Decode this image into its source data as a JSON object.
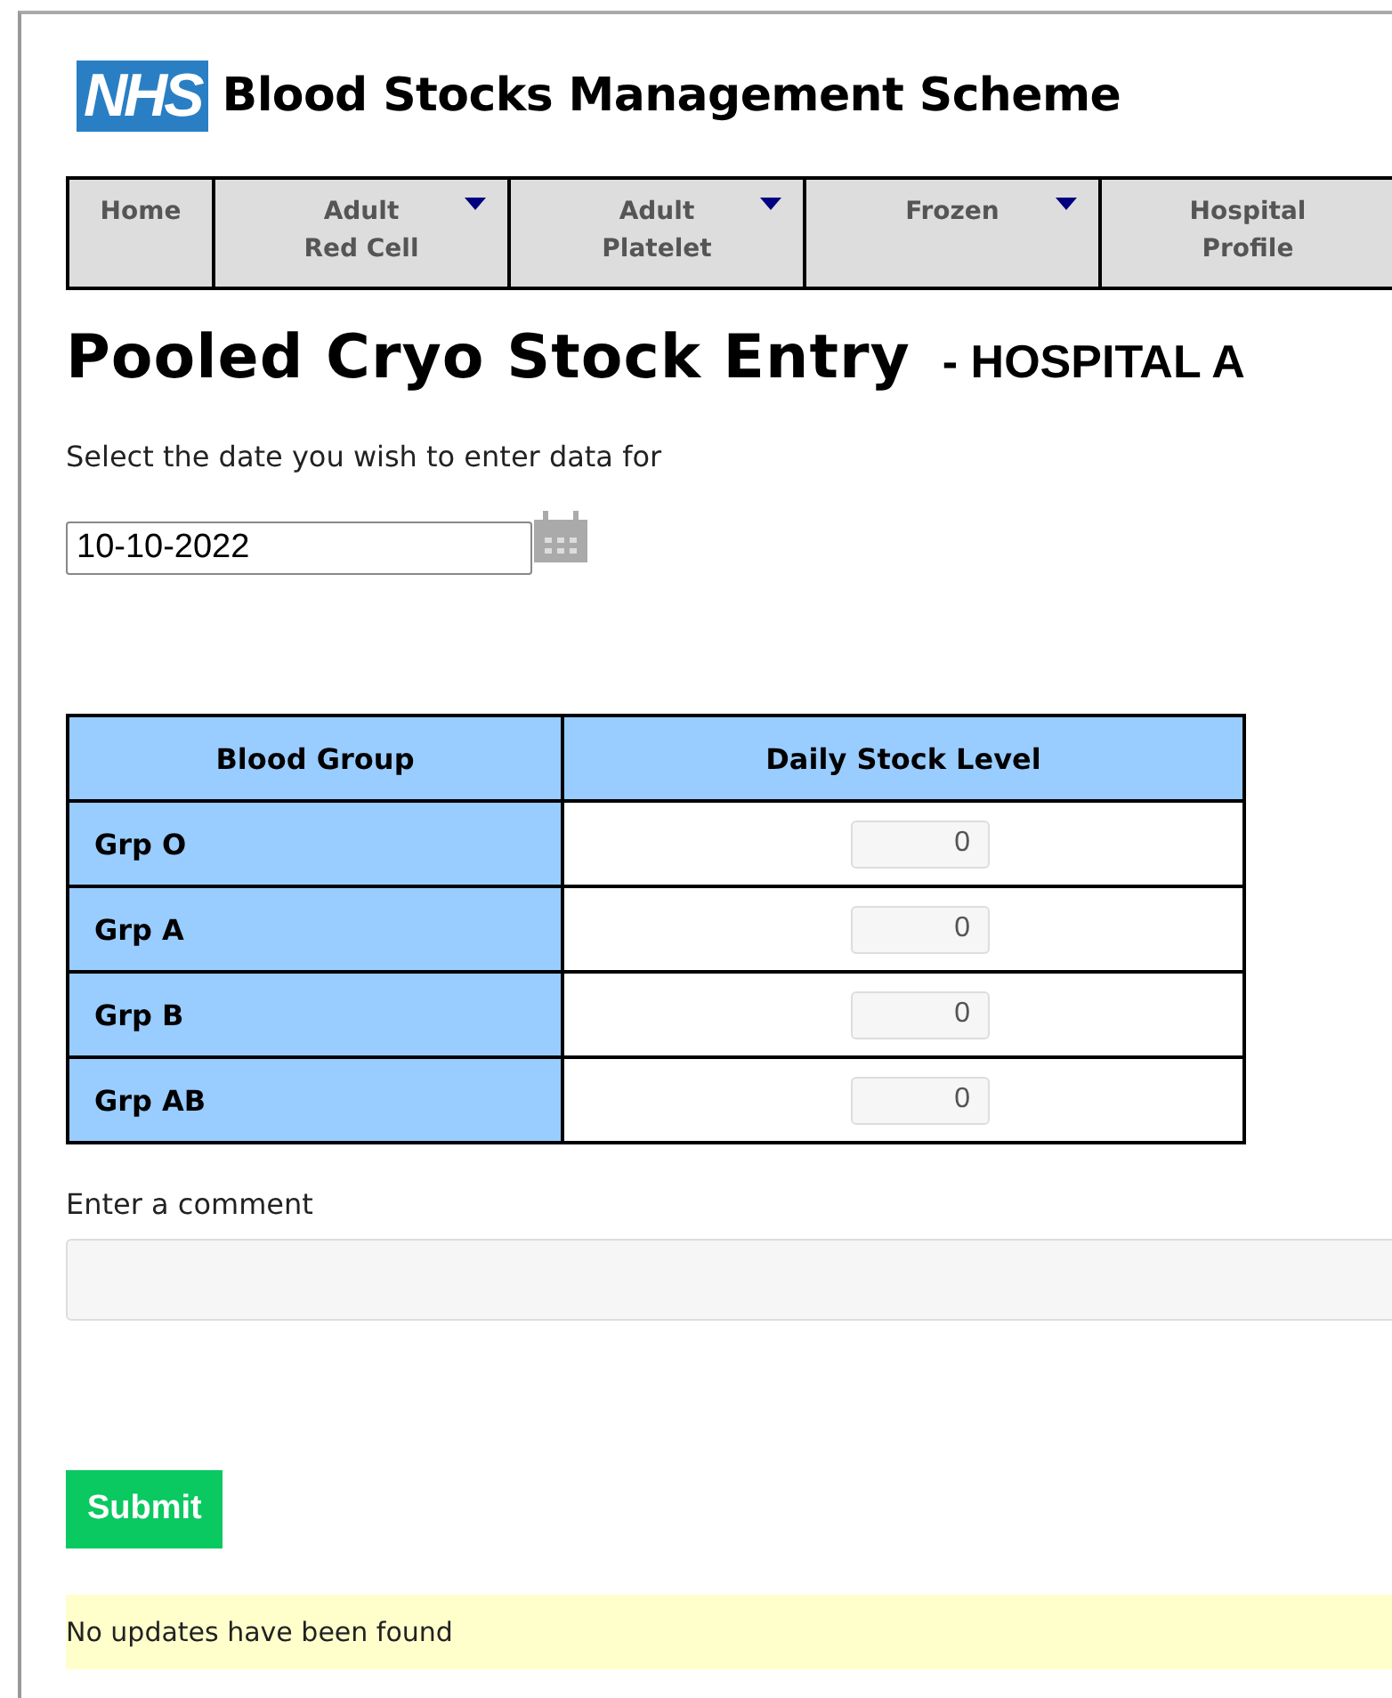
{
  "header": {
    "logo": "NHS",
    "title": "Blood Stocks Management Scheme"
  },
  "nav": [
    {
      "label": "Home",
      "has_menu": false
    },
    {
      "label": "Adult\nRed Cell",
      "has_menu": true
    },
    {
      "label": "Adult\nPlatelet",
      "has_menu": true
    },
    {
      "label": "Frozen",
      "has_menu": true
    },
    {
      "label": "Hospital\nProfile",
      "has_menu": false
    }
  ],
  "page_title": "Pooled Cryo Stock Entry",
  "hospital": "- HOSPITAL A",
  "date_prompt": "Select the date you wish to enter data for",
  "date_value": "10-10-2022",
  "table": {
    "columns": [
      "Blood Group",
      "Daily Stock Level"
    ],
    "rows": [
      {
        "group": "Grp O",
        "level": "0"
      },
      {
        "group": "Grp A",
        "level": "0"
      },
      {
        "group": "Grp B",
        "level": "0"
      },
      {
        "group": "Grp AB",
        "level": "0"
      }
    ]
  },
  "comment_label": "Enter a comment",
  "submit": "Submit",
  "message": "No updates have been found"
}
